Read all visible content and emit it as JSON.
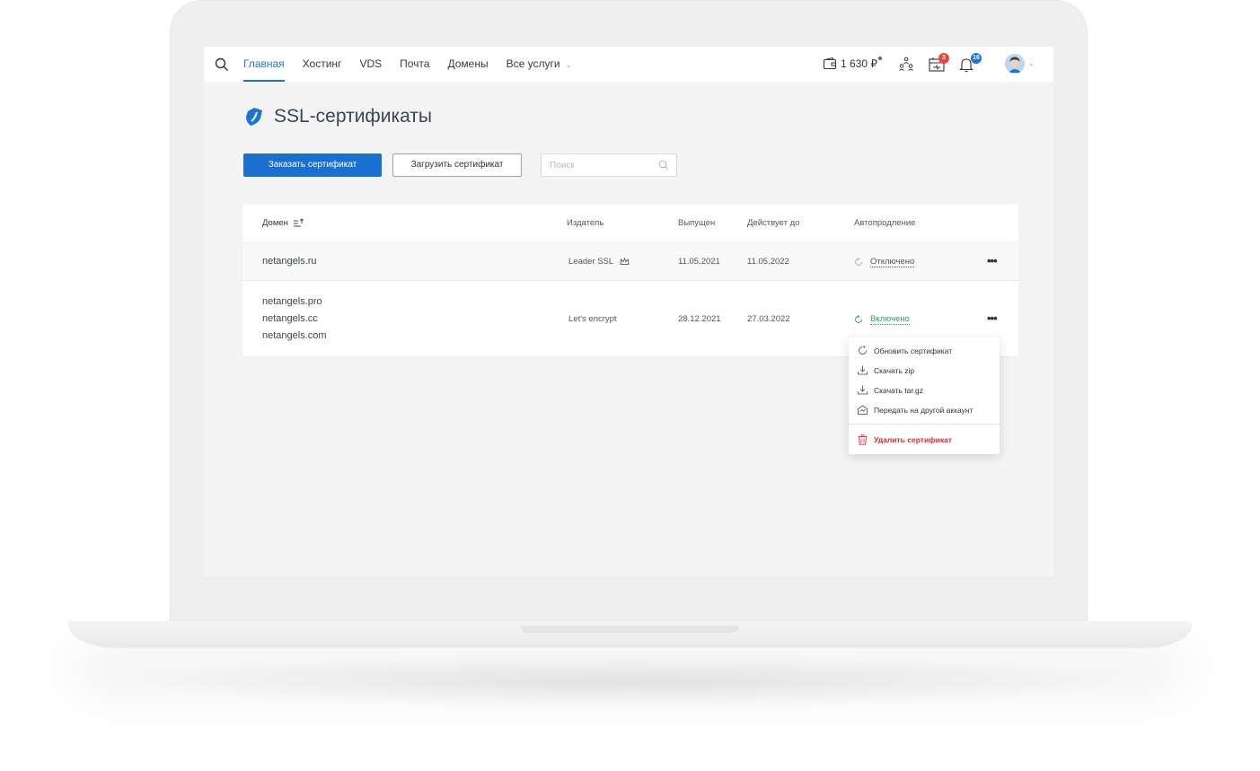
{
  "nav": {
    "items": [
      "Главная",
      "Хостинг",
      "VDS",
      "Почта",
      "Домены",
      "Все услуги"
    ],
    "active_index": 0
  },
  "header": {
    "balance": "1 630 ₽",
    "cart_badge": "3",
    "notifications_badge": "16"
  },
  "page": {
    "title": "SSL-сертификаты"
  },
  "toolbar": {
    "order_label": "Заказать сертификат",
    "upload_label": "Загрузить сертификат",
    "search_placeholder": "Поиск"
  },
  "table": {
    "columns": [
      "Домен",
      "Издатель",
      "Выпущен",
      "Действует до",
      "Автопродление"
    ],
    "rows": [
      {
        "domains": [
          "netangels.ru"
        ],
        "issuer": "Leader SSL",
        "issued": "11.05.2021",
        "valid_until": "11.05.2022",
        "autorenew": "Отключено"
      },
      {
        "domains": [
          "netangels.pro",
          "netangels.cc",
          "netangels.com"
        ],
        "issuer": "Let's encrypt",
        "issued": "28.12.2021",
        "valid_until": "27.03.2022",
        "autorenew": "Включено"
      }
    ]
  },
  "menu": {
    "items": [
      "Обновить сертификат",
      "Скачать zip",
      "Скачать tar.gz",
      "Передать на другой аккаунт"
    ],
    "delete_label": "Удалить сертификат"
  },
  "colors": {
    "accent": "#1c74d4",
    "success": "#2ea45c",
    "danger": "#e0282e"
  }
}
